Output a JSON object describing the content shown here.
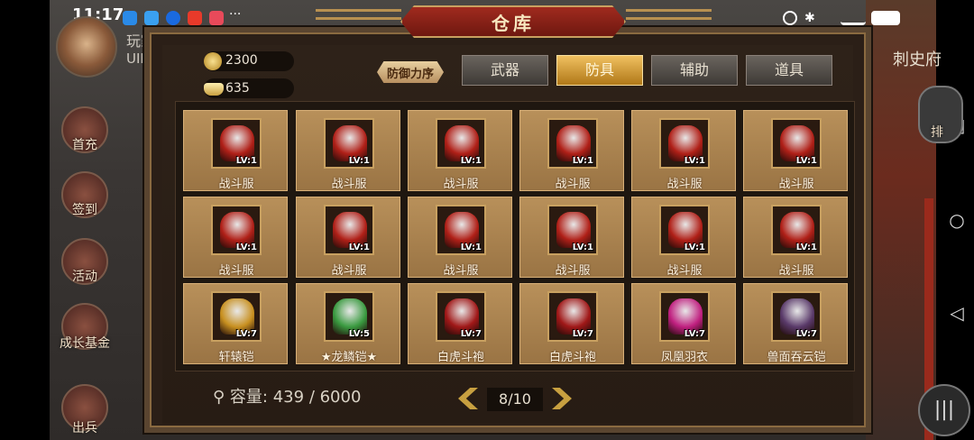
{
  "status_bar": {
    "time": "11:17",
    "more": "···"
  },
  "background": {
    "player_name": "玩家",
    "uid": "UID",
    "city_label": "刺史府",
    "side_buttons": [
      {
        "label": "首充"
      },
      {
        "label": "签到"
      },
      {
        "label": "活动"
      },
      {
        "label": "成长基金"
      },
      {
        "label": "出兵"
      }
    ],
    "rank_label": "排"
  },
  "warehouse": {
    "title": "仓库",
    "currency": [
      {
        "icon": "coin-icon",
        "value": "2300"
      },
      {
        "icon": "ingot-icon",
        "value": "635"
      }
    ],
    "sort_label": "防御力序",
    "tabs": [
      {
        "label": "武器",
        "active": false
      },
      {
        "label": "防具",
        "active": true
      },
      {
        "label": "辅助",
        "active": false
      },
      {
        "label": "道具",
        "active": false
      }
    ],
    "items": [
      {
        "name": "战斗服",
        "level": "LV:1",
        "color": "#b02018"
      },
      {
        "name": "战斗服",
        "level": "LV:1",
        "color": "#b02018"
      },
      {
        "name": "战斗服",
        "level": "LV:1",
        "color": "#b02018"
      },
      {
        "name": "战斗服",
        "level": "LV:1",
        "color": "#b02018"
      },
      {
        "name": "战斗服",
        "level": "LV:1",
        "color": "#b02018"
      },
      {
        "name": "战斗服",
        "level": "LV:1",
        "color": "#b02018"
      },
      {
        "name": "战斗服",
        "level": "LV:1",
        "color": "#b02018"
      },
      {
        "name": "战斗服",
        "level": "LV:1",
        "color": "#b02018"
      },
      {
        "name": "战斗服",
        "level": "LV:1",
        "color": "#b02018"
      },
      {
        "name": "战斗服",
        "level": "LV:1",
        "color": "#b02018"
      },
      {
        "name": "战斗服",
        "level": "LV:1",
        "color": "#b02018"
      },
      {
        "name": "战斗服",
        "level": "LV:1",
        "color": "#b02018"
      },
      {
        "name": "轩辕铠",
        "level": "LV:7",
        "color": "#c89020"
      },
      {
        "name": "★龙鳞铠★",
        "level": "LV:5",
        "color": "#3a9a40"
      },
      {
        "name": "白虎斗袍",
        "level": "LV:7",
        "color": "#a01818"
      },
      {
        "name": "白虎斗袍",
        "level": "LV:7",
        "color": "#a01818"
      },
      {
        "name": "凤凰羽衣",
        "level": "LV:7",
        "color": "#c02080"
      },
      {
        "name": "兽面吞云铠",
        "level": "LV:7",
        "color": "#5a3a6a"
      }
    ],
    "capacity_label": "容量:",
    "capacity_value": "439 / 6000",
    "page": "8/10"
  }
}
